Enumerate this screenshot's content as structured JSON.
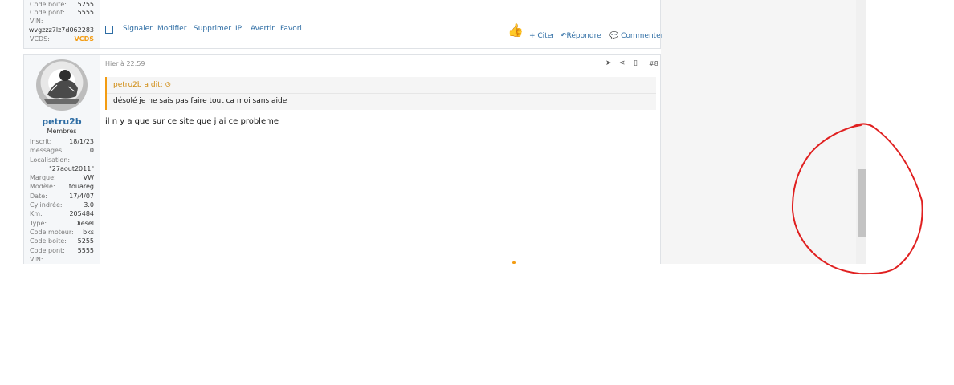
{
  "post_top": {
    "userinfo": [
      {
        "label": "Code boite:",
        "value": "5255"
      },
      {
        "label": "Code pont:",
        "value": "5555"
      },
      {
        "label": "VIN:",
        "value": ""
      },
      {
        "label": "",
        "value": "wvgzzz7lz7d062283"
      },
      {
        "label": "VCDS:",
        "value": "VCDS"
      }
    ],
    "actions": [
      "Signaler",
      "Modifier",
      "Supprimer",
      "IP",
      "Avertir",
      "Favori"
    ],
    "right_actions": {
      "quote": "+ Citer",
      "reply": "Répondre",
      "comment": "Commenter"
    }
  },
  "post_main": {
    "date": "Hier à 22:59",
    "post_number": "#8",
    "username": "petru2b",
    "role": "Membres",
    "userinfo": [
      {
        "label": "Inscrit:",
        "value": "18/1/23"
      },
      {
        "label": "messages:",
        "value": "10"
      },
      {
        "label": "Localisation:",
        "value": ""
      },
      {
        "label": "",
        "value": "\"27aout2011\""
      },
      {
        "label": "Marque:",
        "value": "VW"
      },
      {
        "label": "Modèle:",
        "value": "touareg"
      },
      {
        "label": "Date:",
        "value": "17/4/07"
      },
      {
        "label": "Cylindrée:",
        "value": "3.0"
      },
      {
        "label": "Km:",
        "value": "205484"
      },
      {
        "label": "Type:",
        "value": "Diesel"
      },
      {
        "label": "Code moteur:",
        "value": "bks"
      },
      {
        "label": "Code boite:",
        "value": "5255"
      },
      {
        "label": "Code pont:",
        "value": "5555"
      },
      {
        "label": "VIN:",
        "value": ""
      }
    ],
    "quote_author": "petru2b a dit:",
    "quote_text": "désolé je ne sais pas faire tout ca moi sans aide",
    "text": "il n y a que sur ce site que j ai ce probleme"
  },
  "annotation": {
    "color": "#e02020"
  }
}
